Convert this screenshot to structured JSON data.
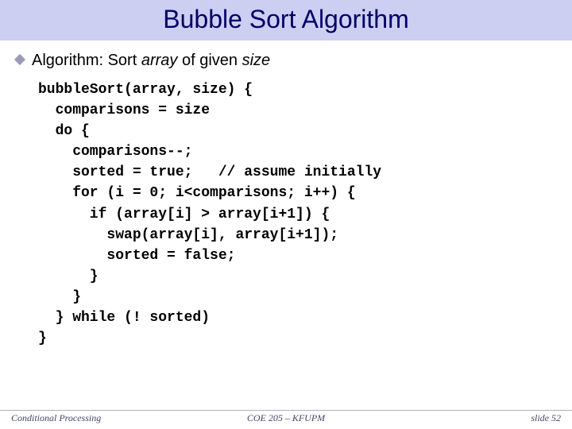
{
  "title": "Bubble Sort Algorithm",
  "bullet": {
    "prefix": "Algorithm: Sort ",
    "italic1": "array",
    "mid": " of given ",
    "italic2": "size"
  },
  "code": "bubbleSort(array, size) {\n  comparisons = size\n  do {\n    comparisons--;\n    sorted = true;   // assume initially\n    for (i = 0; i<comparisons; i++) {\n      if (array[i] > array[i+1]) {\n        swap(array[i], array[i+1]);\n        sorted = false;\n      }\n    }\n  } while (! sorted)\n}",
  "footer": {
    "left": "Conditional Processing",
    "center": "COE 205 – KFUPM",
    "right": "slide 52"
  }
}
